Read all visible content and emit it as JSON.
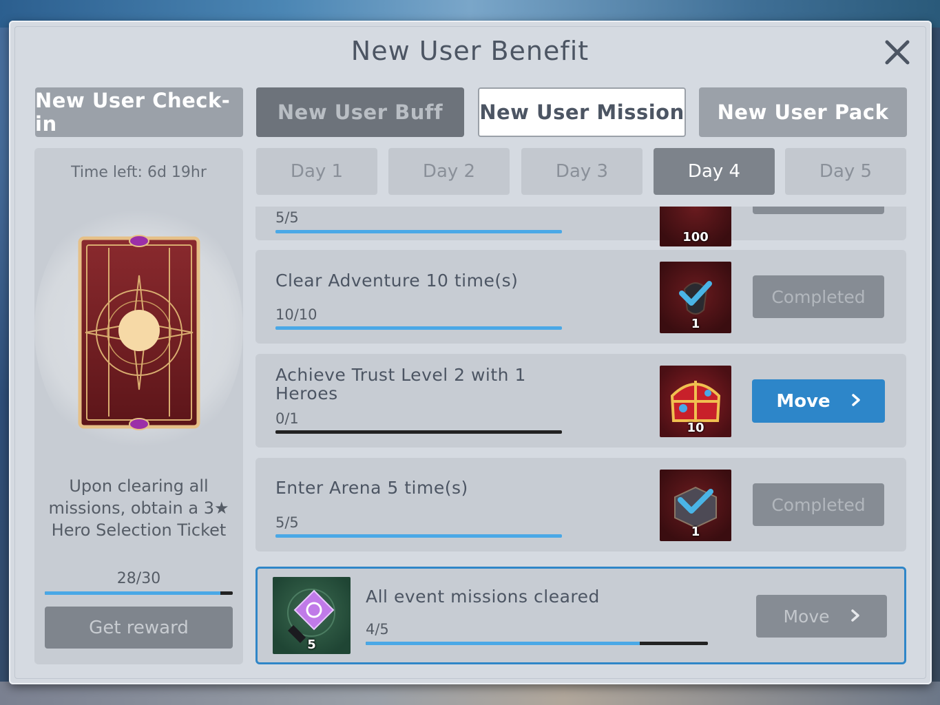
{
  "dialog": {
    "title": "New User Benefit"
  },
  "tabs": [
    {
      "label": "New User Check-in",
      "state": "normal"
    },
    {
      "label": "New User Buff",
      "state": "disabled"
    },
    {
      "label": "New User Mission",
      "state": "selected"
    },
    {
      "label": "New User Pack",
      "state": "normal"
    }
  ],
  "sidebar": {
    "time_left": "Time left: 6d 19hr",
    "description": "Upon clearing all missions, obtain a 3★ Hero Selection Ticket",
    "progress_text": "28/30",
    "progress_fraction": 0.933,
    "button_label": "Get reward"
  },
  "days": [
    {
      "label": "Day 1"
    },
    {
      "label": "Day 2"
    },
    {
      "label": "Day 3"
    },
    {
      "label": "Day 4",
      "active": true
    },
    {
      "label": "Day 5"
    }
  ],
  "missions": [
    {
      "name": "",
      "progress": "5/5",
      "fraction": 1.0,
      "reward_qty": "100",
      "icon": "partially-visible-reward-icon"
    },
    {
      "name": "Clear Adventure 10 time(s)",
      "progress": "10/10",
      "fraction": 1.0,
      "reward_qty": "1",
      "icon": "reward-item-claimed-icon",
      "button": "Completed"
    },
    {
      "name": "Achieve Trust Level 2 with 1 Heroes",
      "progress": "0/1",
      "fraction": 0.0,
      "reward_qty": "10",
      "icon": "treasure-chest-icon",
      "button": "Move"
    },
    {
      "name": "Enter Arena 5 time(s)",
      "progress": "5/5",
      "fraction": 1.0,
      "reward_qty": "1",
      "icon": "reward-box-claimed-icon",
      "button": "Completed"
    }
  ],
  "summary": {
    "name": "All event missions cleared",
    "progress": "4/5",
    "fraction": 0.8,
    "reward_qty": "5",
    "icon": "hero-ticket-icon",
    "button": "Move"
  },
  "colors": {
    "accent_blue": "#2d86c9",
    "progress_blue": "#4aa8e6",
    "panel": "#d5dae1",
    "text_dark": "#4c5563"
  }
}
